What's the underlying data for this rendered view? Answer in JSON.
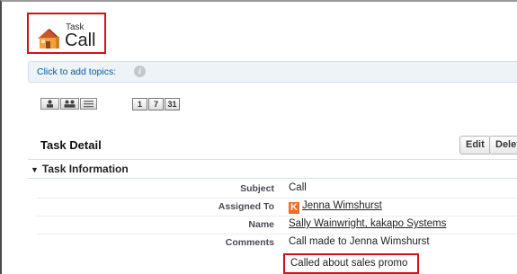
{
  "header": {
    "object_type": "Task",
    "record_name": "Call",
    "icon": "task-house-icon"
  },
  "topics": {
    "link_text": "Click to add topics:",
    "info_icon": "i"
  },
  "calendar_views": [
    "1",
    "7",
    "31"
  ],
  "detail": {
    "title": "Task Detail",
    "edit_label": "Edit",
    "delete_label": "Delet"
  },
  "section": {
    "title": "Task Information"
  },
  "fields": {
    "subject": {
      "label": "Subject",
      "value": "Call"
    },
    "assigned_to": {
      "label": "Assigned To",
      "value": "Jenna Wimshurst",
      "badge": "K"
    },
    "name": {
      "label": "Name",
      "value": "Sally Wainwright, kakapo Systems"
    },
    "comments": {
      "label": "Comments",
      "value": "Call made to Jenna Wimshurst",
      "value2": "Called about sales promo"
    }
  },
  "colors": {
    "highlight": "#d0121b",
    "link": "#015ba7",
    "user_badge": "#f16b22"
  }
}
